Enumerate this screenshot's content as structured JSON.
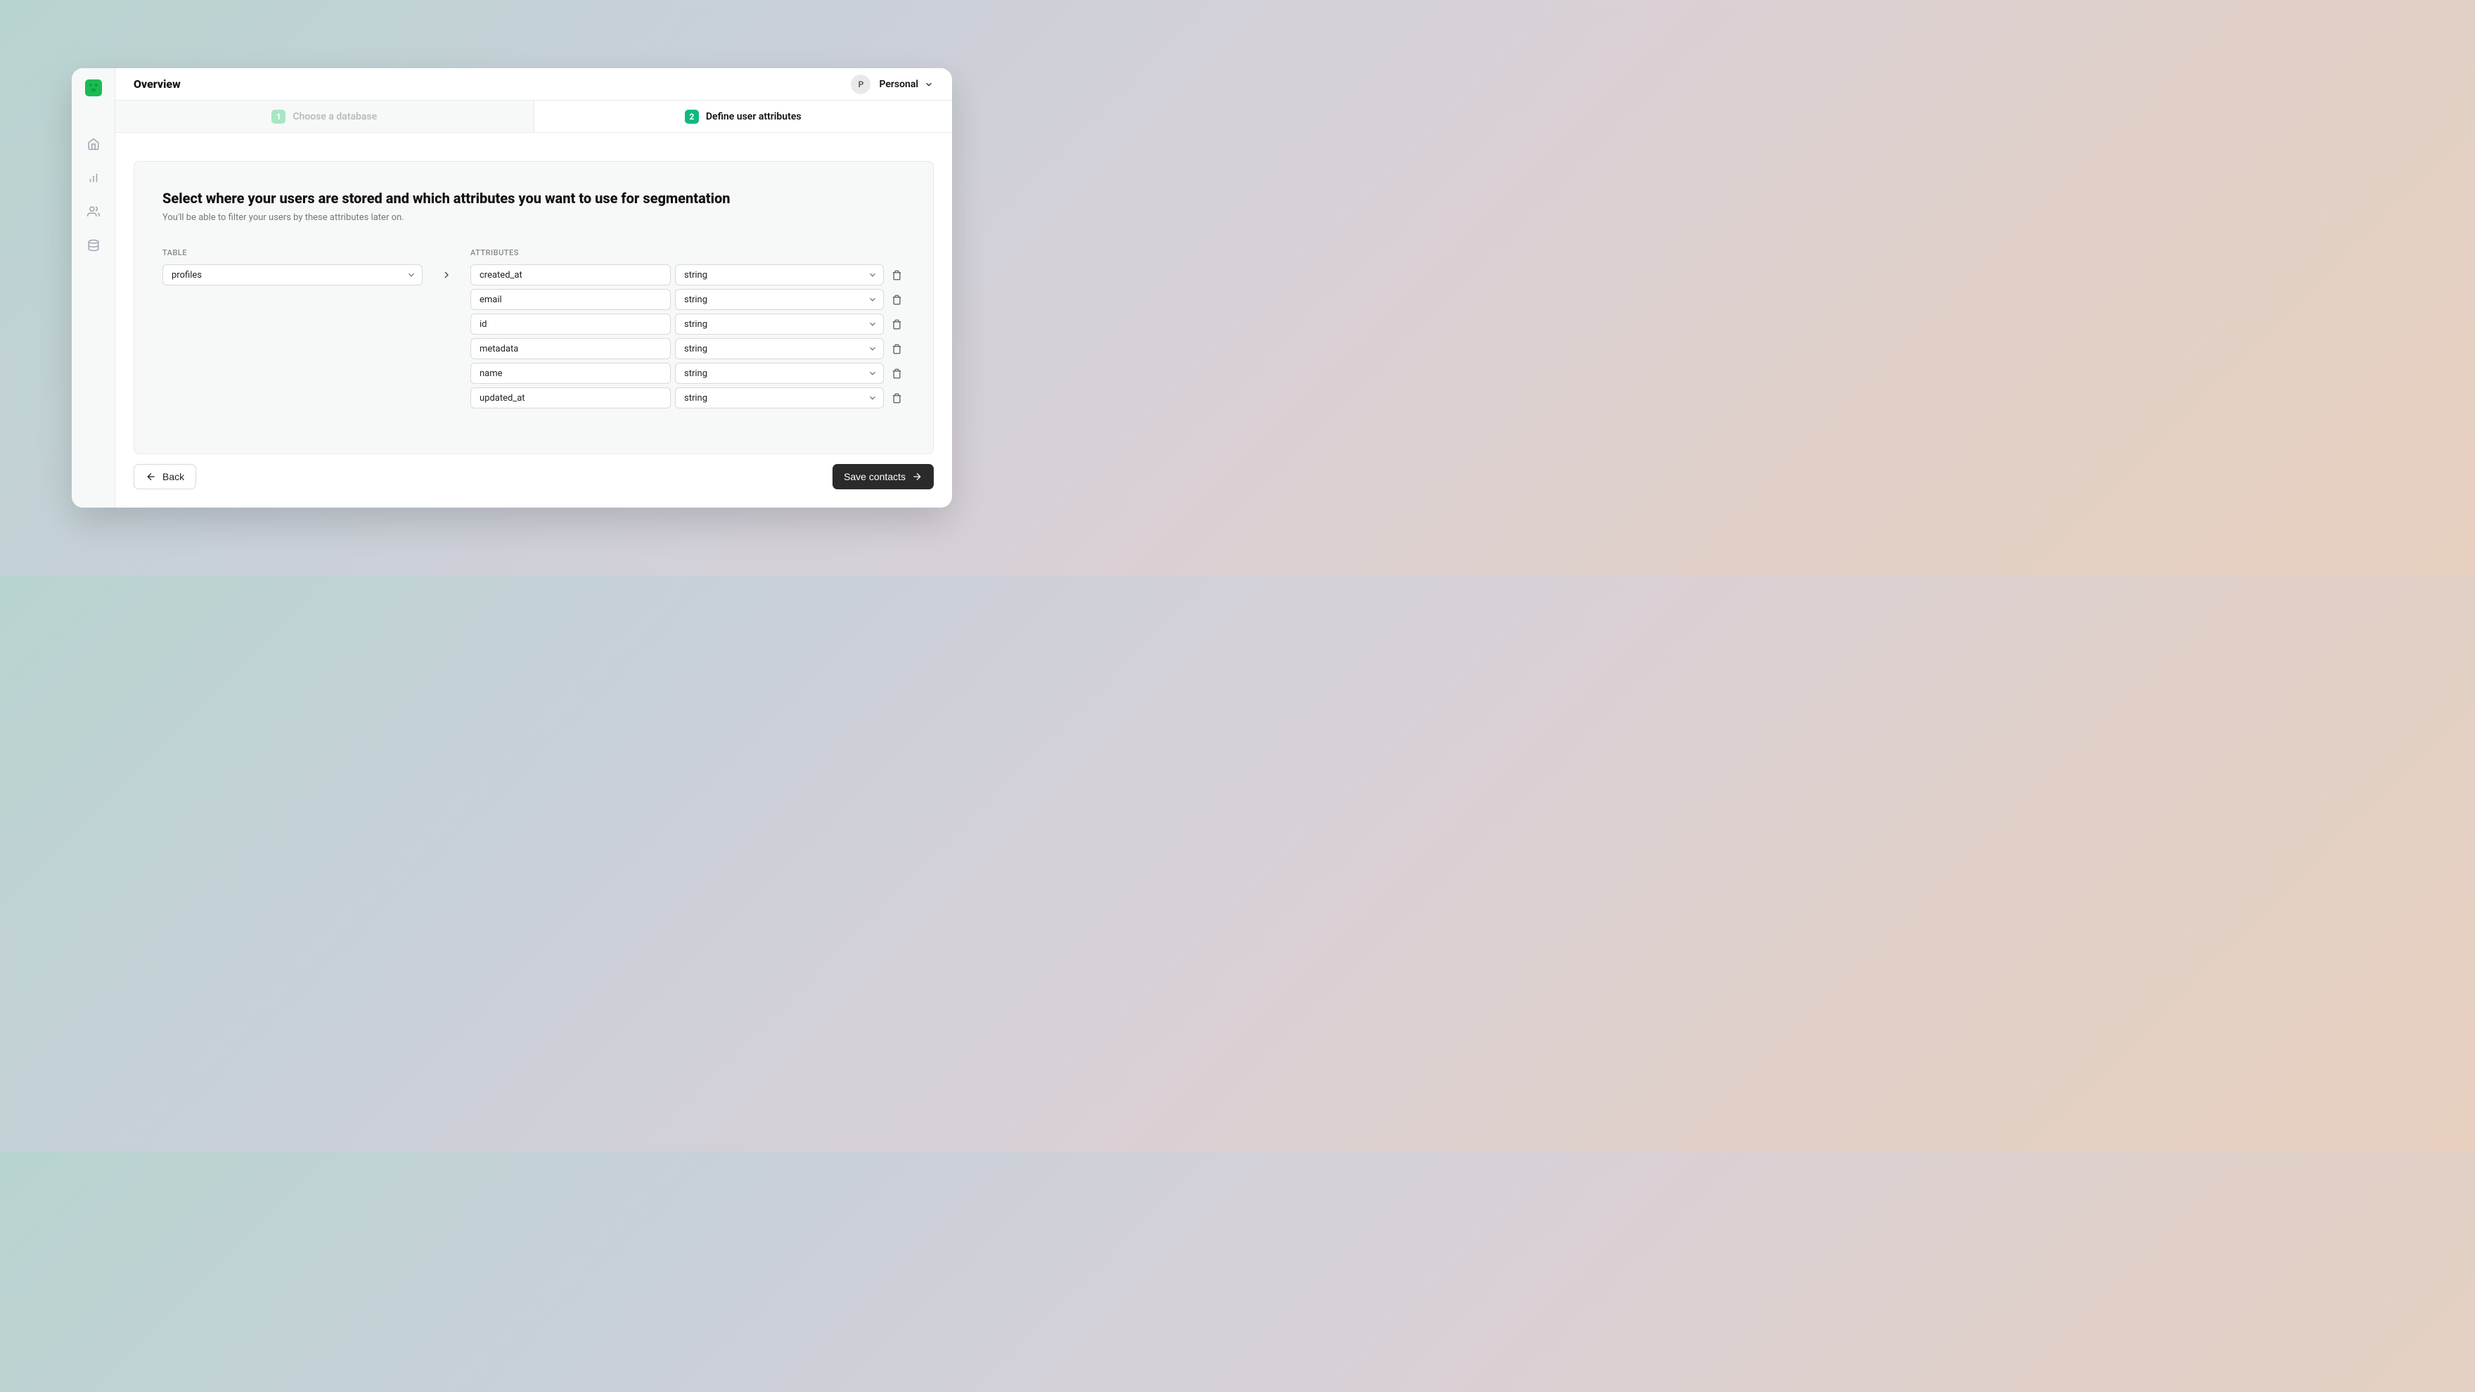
{
  "header": {
    "title": "Overview",
    "avatar_letter": "P",
    "workspace": "Personal"
  },
  "steps": [
    {
      "num": "1",
      "label": "Choose a database",
      "active": false
    },
    {
      "num": "2",
      "label": "Define user attributes",
      "active": true
    }
  ],
  "panel": {
    "title": "Select where your users are stored and which attributes you want to use for segmentation",
    "subtitle": "You'll be able to filter your users by these attributes later on.",
    "table_label": "TABLE",
    "attrs_label": "ATTRIBUTES",
    "table_value": "profiles",
    "attributes": [
      {
        "name": "created_at",
        "type": "string"
      },
      {
        "name": "email",
        "type": "string"
      },
      {
        "name": "id",
        "type": "string"
      },
      {
        "name": "metadata",
        "type": "string"
      },
      {
        "name": "name",
        "type": "string"
      },
      {
        "name": "updated_at",
        "type": "string"
      }
    ]
  },
  "actions": {
    "back": "Back",
    "save": "Save contacts"
  }
}
